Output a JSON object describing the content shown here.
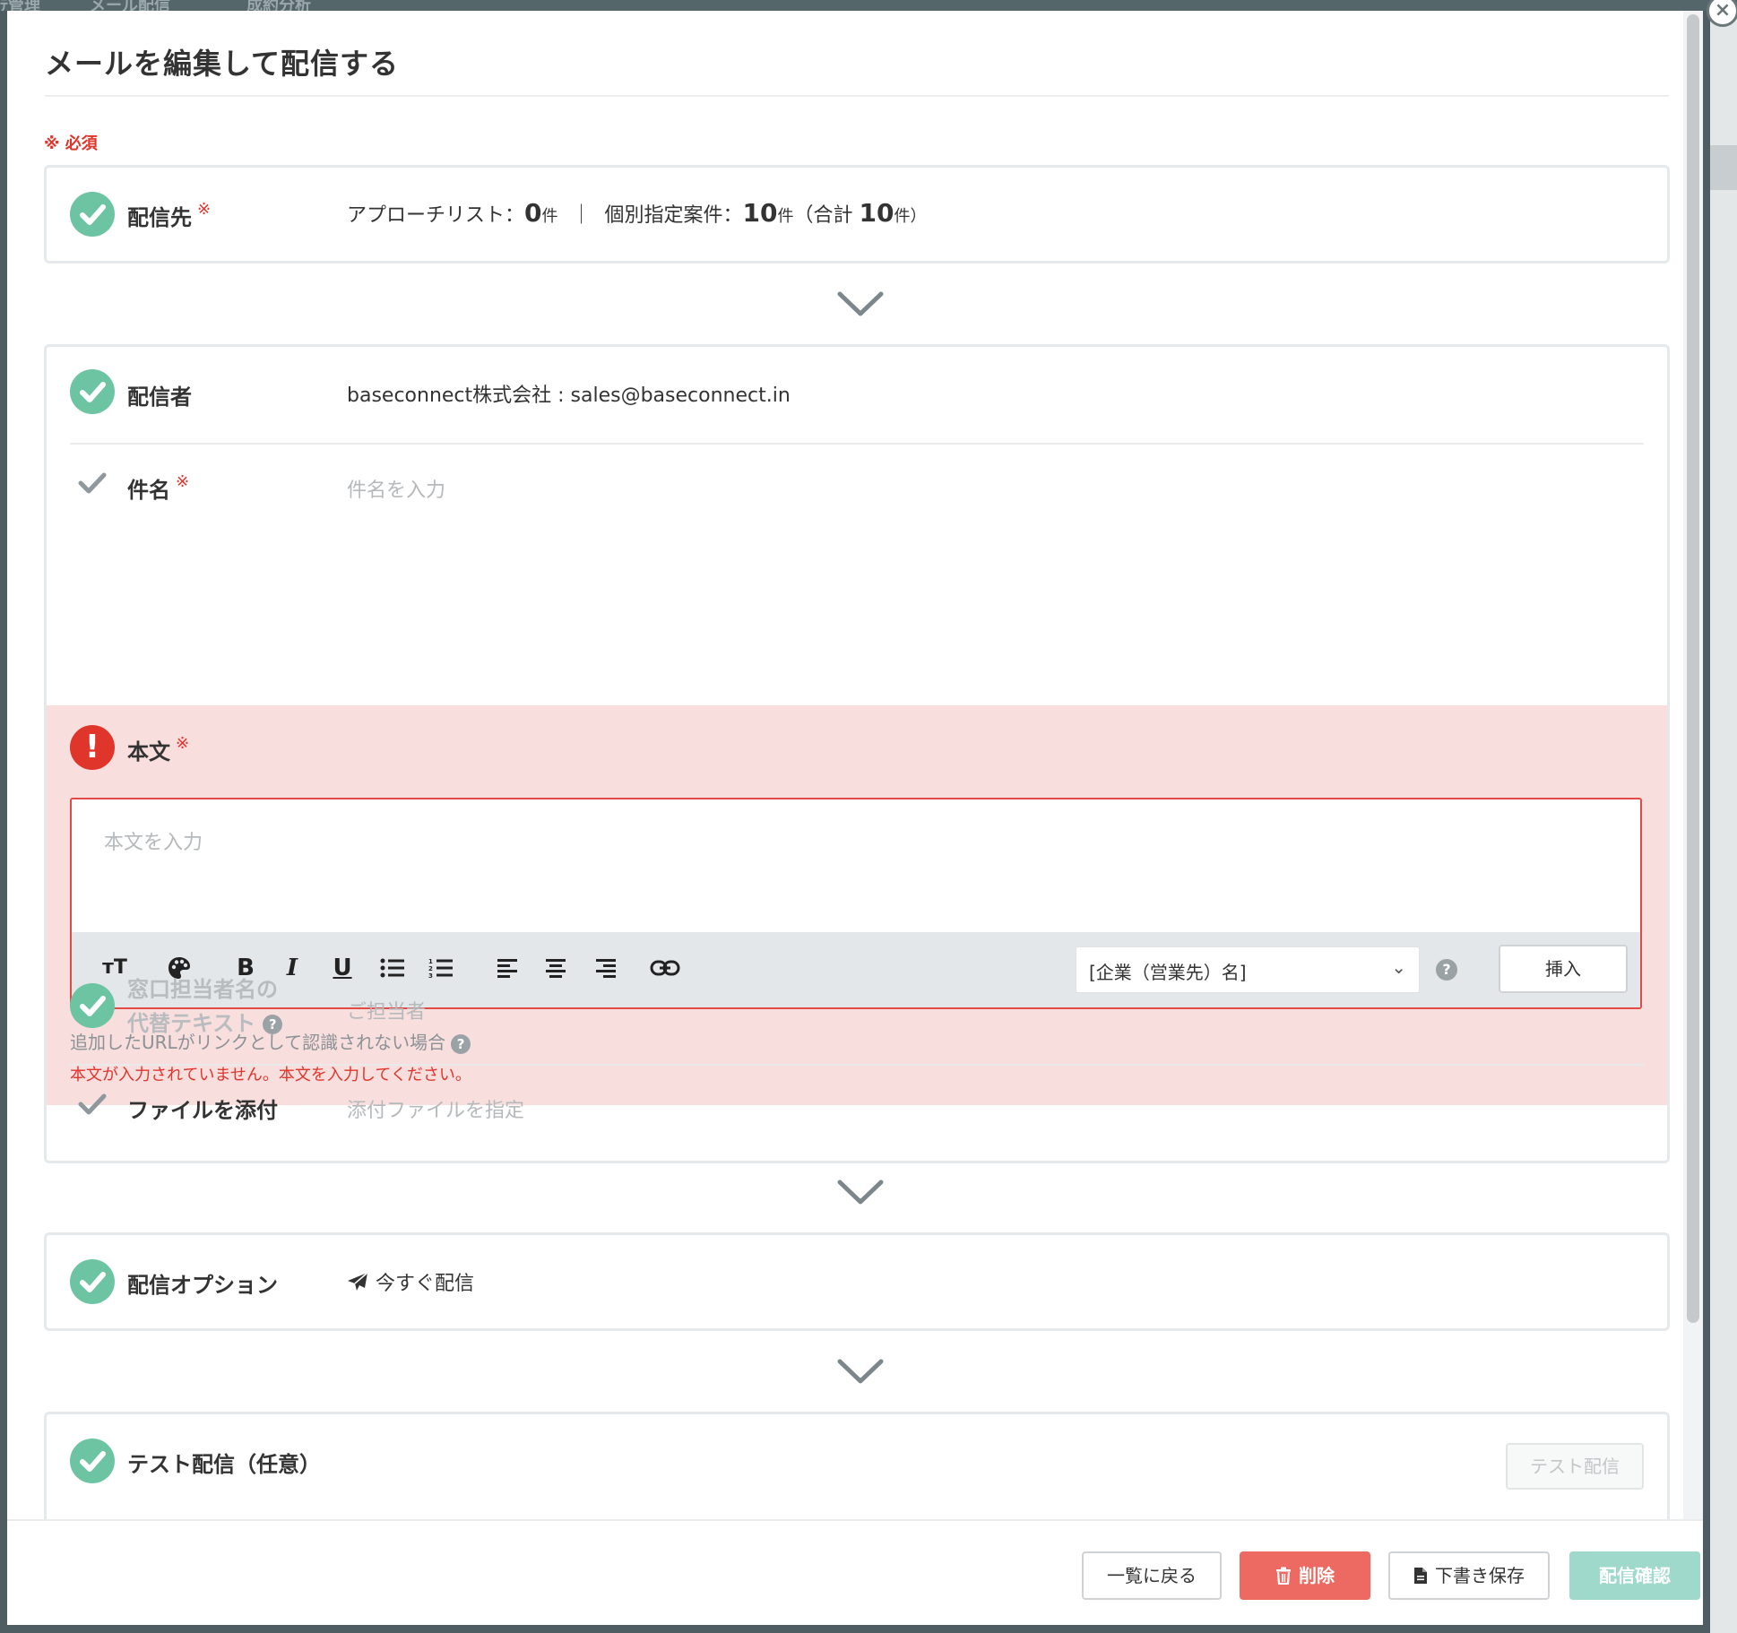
{
  "background": {
    "nav_items": [
      "ﾃ管理",
      "メール配信",
      "成約分析"
    ]
  },
  "modal": {
    "title": "メールを編集して配信する",
    "required_note": "※ 必須",
    "required_mark": "※",
    "close_label": "×"
  },
  "recipients": {
    "label": "配信先",
    "approach_prefix": "アプローチリスト：",
    "approach_count": "0",
    "unit": "件",
    "separator": "｜",
    "individual_prefix": "個別指定案件：",
    "individual_count": "10",
    "total_prefix": "（合計 ",
    "total_count": "10",
    "total_suffix": "件）"
  },
  "sender": {
    "label": "配信者",
    "value": "baseconnect株式会社 : sales@baseconnect.in"
  },
  "subject": {
    "label": "件名",
    "placeholder": "件名を入力"
  },
  "body": {
    "label": "本文",
    "placeholder": "本文を入力",
    "error_icon": "!",
    "toolbar": {
      "text_size": "тT",
      "bold": "B",
      "italic": "I",
      "underline": "U",
      "merge_field_selected": "[企業（営業先）名]",
      "help": "?",
      "insert_label": "挿入"
    },
    "url_hint": "追加したURLがリンクとして認識されない場合",
    "error_message": "本文が入力されていません。本文を入力してください。"
  },
  "contact_alt": {
    "label_line1": "窓口担当者名の",
    "label_line2": "代替テキスト",
    "placeholder": "ご担当者"
  },
  "attachment": {
    "label": "ファイルを添付",
    "placeholder": "添付ファイルを指定"
  },
  "delivery_option": {
    "label": "配信オプション",
    "value": "今すぐ配信"
  },
  "test_delivery": {
    "label": "テスト配信（任意）",
    "button": "テスト配信"
  },
  "footer": {
    "back": "一覧に戻る",
    "delete": "削除",
    "save_draft": "下書き保存",
    "confirm": "配信確認"
  },
  "colors": {
    "check_green": "#6cc4a3",
    "error_red": "#e0352b",
    "error_bg": "#f9dede",
    "delete_red": "#ec6a62",
    "confirm_disabled": "#9fd9cc"
  }
}
